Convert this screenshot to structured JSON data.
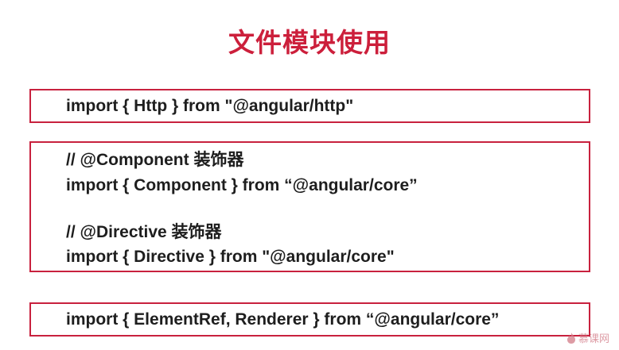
{
  "slide": {
    "title": "文件模块使用"
  },
  "blocks": [
    {
      "lines": [
        "import { Http } from \"@angular/http\""
      ]
    },
    {
      "lines": [
        "// @Component 装饰器",
        "import { Component } from “@angular/core”",
        "// @Directive 装饰器",
        "import { Directive } from \"@angular/core\""
      ]
    },
    {
      "lines": [
        "import { ElementRef, Renderer } from “@angular/core”"
      ]
    }
  ],
  "watermark": {
    "text": "慕课网",
    "icon": "flame-logo-icon"
  },
  "colors": {
    "accent": "#cc1f3b",
    "border": "#c8213e",
    "text": "#1e1e1e"
  }
}
